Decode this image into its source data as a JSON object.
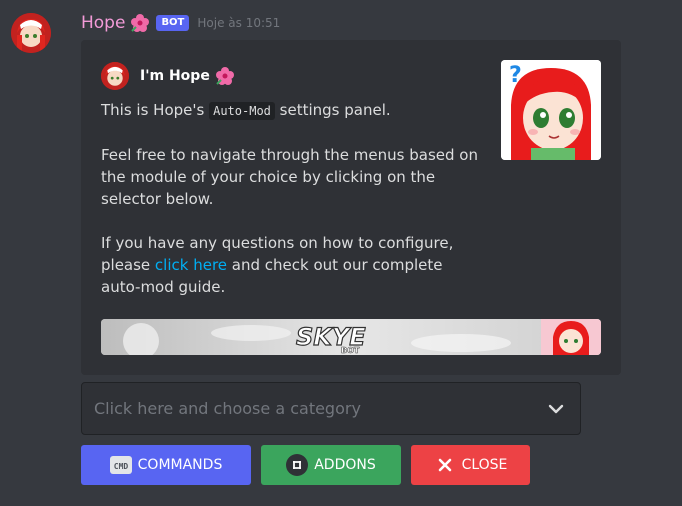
{
  "message": {
    "author": "Hope",
    "bot_tag": "BOT",
    "timestamp": "Hoje às 10:51",
    "colors": {
      "username": "#f39bd8",
      "bot_tag": "#5865f2"
    }
  },
  "embed": {
    "author_name": "I'm Hope",
    "description": {
      "p1_before": "This is Hope's ",
      "p1_code": "Auto-Mod",
      "p1_after": " settings panel.",
      "p2": "Feel free to navigate through the menus based on the module of your choice by clicking on the selector below.",
      "p3_before": "If you have any questions on how to configure, please ",
      "p3_link": "click here",
      "p3_after": " and check out our complete auto-mod guide."
    },
    "banner_text": "SKYE",
    "banner_subtext": "BOT",
    "link_color": "#00aff4"
  },
  "select": {
    "placeholder": "Click here and choose a category"
  },
  "buttons": {
    "commands": {
      "label": "COMMANDS",
      "icon": "cmd-icon",
      "color": "#5865f2"
    },
    "addons": {
      "label": "ADDONS",
      "icon": "puzzle-icon",
      "color": "#3ba55d"
    },
    "close": {
      "label": "CLOSE",
      "icon": "close-icon",
      "color": "#ed4245"
    }
  }
}
